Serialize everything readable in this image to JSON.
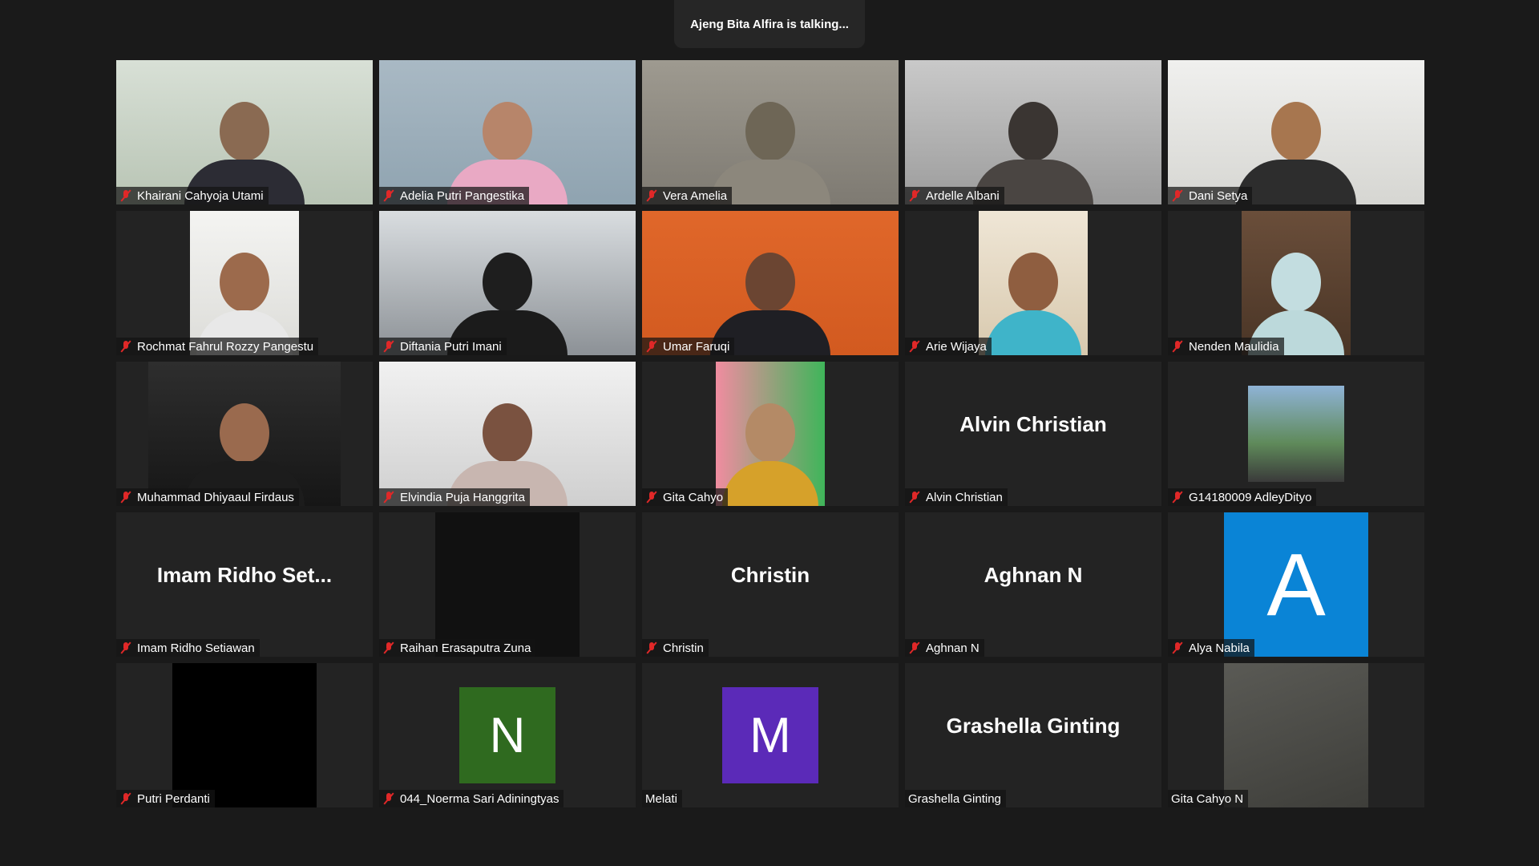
{
  "banner": {
    "text": "Ajeng Bita Alfira is talking..."
  },
  "tiles": [
    {
      "name": "Khairani Cahyoja Utami"
    },
    {
      "name": "Adelia Putri Pangestika"
    },
    {
      "name": "Vera Amelia"
    },
    {
      "name": "Ardelle Albani"
    },
    {
      "name": "Dani Setya"
    },
    {
      "name": "Rochmat Fahrul Rozzy Pangestu"
    },
    {
      "name": "Diftania Putri Imani"
    },
    {
      "name": "Umar Faruqi"
    },
    {
      "name": "Arie Wijaya"
    },
    {
      "name": "Nenden Maulidia"
    },
    {
      "name": "Muhammad Dhiyaaul Firdaus"
    },
    {
      "name": "Elvindia Puja Hanggrita"
    },
    {
      "name": "Gita Cahyo"
    },
    {
      "name": "Alvin Christian",
      "center_label": "Alvin Christian"
    },
    {
      "name": "G14180009 AdleyDityo"
    },
    {
      "name": "Imam Ridho Setiawan",
      "center_label": "Imam  Ridho  Set..."
    },
    {
      "name": "Raihan Erasaputra Zuna"
    },
    {
      "name": "Christin",
      "center_label": "Christin"
    },
    {
      "name": "Aghnan N",
      "center_label": "Aghnan N"
    },
    {
      "name": "Alya Nabila",
      "avatar_letter": "A",
      "avatar_color": "#0a84d6"
    },
    {
      "name": "Putri Perdanti"
    },
    {
      "name": "044_Noerma Sari Adiningtyas",
      "avatar_letter": "N",
      "avatar_color": "#2f6a1f"
    },
    {
      "name": "Melati",
      "avatar_letter": "M",
      "avatar_color": "#5b2ab8"
    },
    {
      "name": "Grashella Ginting",
      "center_label": "Grashella Ginting"
    },
    {
      "name": "Gita Cahyo N"
    }
  ],
  "icons": {
    "muted_mic": "mic-muted-icon"
  },
  "colors": {
    "background": "#1a1a1a",
    "tile": "#232323",
    "muted": "#e02828"
  }
}
